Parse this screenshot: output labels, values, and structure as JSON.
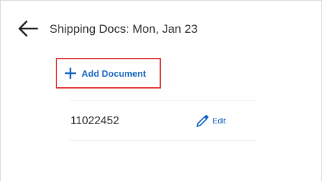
{
  "header": {
    "title": "Shipping Docs: Mon, Jan 23",
    "back_icon": "arrow-left-icon"
  },
  "actions": {
    "add_document_label": "Add Document",
    "add_icon": "plus-icon"
  },
  "documents": [
    {
      "number": "11022452",
      "edit_label": "Edit",
      "edit_icon": "pencil-icon"
    }
  ],
  "colors": {
    "accent": "#1565c0",
    "highlight_border": "#e03a33",
    "text": "#2b2b2b"
  }
}
